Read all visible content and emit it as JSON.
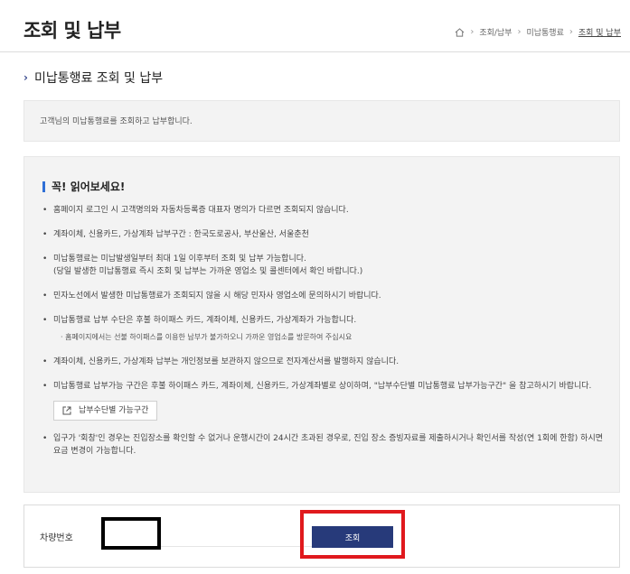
{
  "page_title": "조회 및 납부",
  "breadcrumb": {
    "items": [
      "조회/납부",
      "미납통행료",
      "조회 및 납부"
    ]
  },
  "section_title": "미납통행료 조회 및 납부",
  "description": "고객님의 미납통행료를 조회하고 납부합니다.",
  "notice": {
    "title": "꼭! 읽어보세요!",
    "items": [
      "홈페이지 로그인 시 고객명의와 자동차등록증 대표자 명의가 다르면 조회되지 않습니다.",
      "계좌이체, 신용카드, 가상계좌 납부구간 : 한국도로공사, 부산울산, 서울춘천",
      "미납통행료는 미납발생일부터 최대 1일 이후부터 조회 및 납부 가능합니다.",
      "(당일 발생한 미납통행료 즉시 조회 및 납부는 가까운 영업소 및 콜센터에서 확인 바랍니다.)",
      "민자노선에서 발생한 미납통행료가 조회되지 않을 시 해당 민자사 영업소에 문의하시기 바랍니다.",
      "미납통행료 납부 수단은 후불 하이패스 카드, 계좌이체, 신용카드, 가상계좌가 가능합니다.",
      "홈페이지에서는 선불 하이패스를 이용한 납부가 불가하오니 가까운 영업소를 방문하여 주십시요",
      "계좌이체, 신용카드, 가상계좌 납부는 개인정보를 보관하지 않으므로 전자계산서를 발행하지 않습니다.",
      "미납통행료 납부가능 구간은 후불 하이패스 카드, 계좌이체, 신용카드, 가상계좌별로 상이하며, \"납부수단별 미납통행료 납부가능구간\" 을 참고하시기 바랍니다.",
      "입구가 '회창'인 경우는 진입장소를 확인할 수 없거나 운행시간이 24시간 초과된 경우로, 진입 장소 증빙자료를 제출하시거나 확인서를 작성(연 1회에 한함) 하시면 요금 변경이 가능합니다."
    ],
    "guide_button": "납부수단별 가능구간"
  },
  "search": {
    "label": "차량번호",
    "value": "",
    "button": "조회"
  },
  "colors": {
    "accent": "#273a7a",
    "notice_bar": "#2f6fd6",
    "highlight": "#e0191d",
    "panel_bg": "#f3f3f3"
  }
}
